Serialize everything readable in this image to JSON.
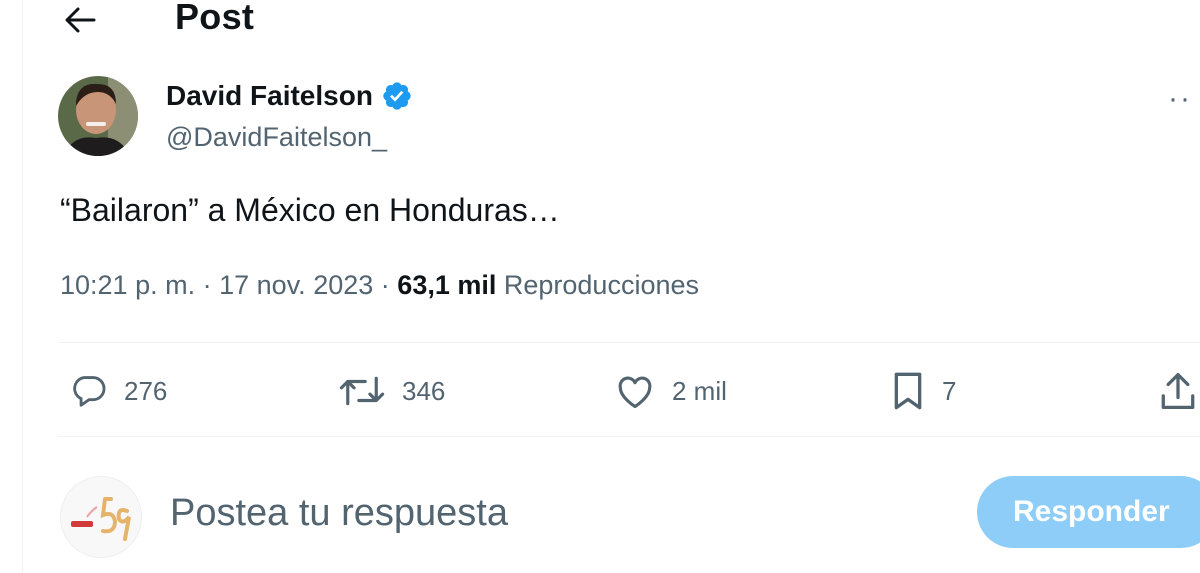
{
  "header": {
    "title": "Post",
    "back_icon": "arrow-left-icon"
  },
  "author": {
    "name": "David Faitelson",
    "handle": "@DavidFaitelson_",
    "verified": true,
    "verified_color": "#1d9bf0"
  },
  "post": {
    "text": "“Bailaron” a México en Honduras…",
    "time": "10:21 p. m.",
    "separator": "·",
    "date": "17 nov. 2023",
    "views_count": "63,1 mil",
    "views_label": "Reproducciones"
  },
  "actions": {
    "replies": "276",
    "reposts": "346",
    "likes": "2 mil",
    "bookmarks": "7"
  },
  "composer": {
    "placeholder": "Postea tu respuesta",
    "button_label": "Responder",
    "button_color": "#8ecdf8"
  },
  "colors": {
    "text_primary": "#0f1419",
    "text_secondary": "#536471",
    "divider": "#eff3f4"
  }
}
